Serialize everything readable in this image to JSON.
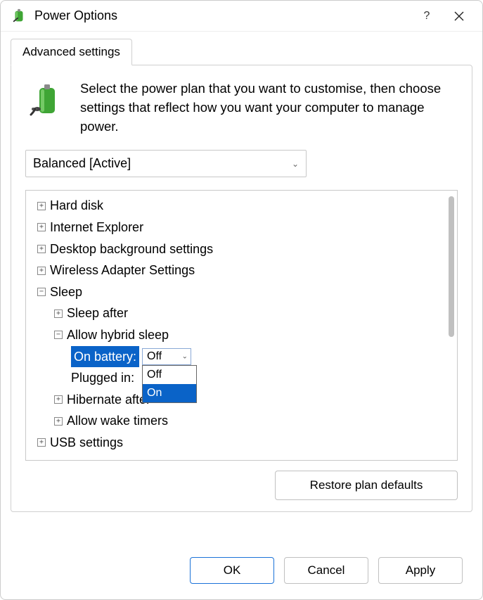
{
  "window": {
    "title": "Power Options"
  },
  "tab": {
    "label": "Advanced settings"
  },
  "intro": {
    "text": "Select the power plan that you want to customise, then choose settings that reflect how you want your computer to manage power."
  },
  "plan_select": {
    "value": "Balanced [Active]"
  },
  "tree": {
    "hard_disk": "Hard disk",
    "ie": "Internet Explorer",
    "desktop_bg": "Desktop background settings",
    "wireless": "Wireless Adapter Settings",
    "sleep": "Sleep",
    "sleep_after": "Sleep after",
    "hybrid": "Allow hybrid sleep",
    "on_battery_label": "On battery:",
    "on_battery_value": "Off",
    "plugged_in_label": "Plugged in:",
    "hibernate_after": "Hibernate after",
    "wake_timers": "Allow wake timers",
    "usb": "USB settings"
  },
  "dropdown": {
    "opt_off": "Off",
    "opt_on": "On"
  },
  "buttons": {
    "restore": "Restore plan defaults",
    "ok": "OK",
    "cancel": "Cancel",
    "apply": "Apply"
  }
}
